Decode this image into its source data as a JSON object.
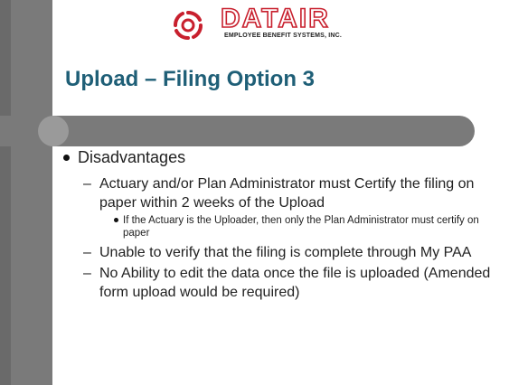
{
  "logo": {
    "wordmark": "DATAIR",
    "subtitle": "EMPLOYEE BENEFIT SYSTEMS, INC.",
    "icon": "datair-swirl-logo-icon"
  },
  "slide": {
    "title": "Upload – Filing Option 3",
    "bullets": [
      {
        "text": "Disadvantages",
        "sub": [
          {
            "text": "Actuary and/or Plan Administrator must Certify the filing on paper within 2 weeks of the Upload",
            "sub": [
              "If the Actuary is the Uploader, then only the Plan Administrator must certify on paper"
            ]
          },
          {
            "text": "Unable to verify that the filing is complete through My PAA"
          },
          {
            "text": "No Ability to edit the data once the file is uploaded (Amended form upload would be required)"
          }
        ]
      }
    ]
  },
  "colors": {
    "title": "#1f5f77",
    "bars": "#7a7a7a",
    "logo_red": "#c8202e"
  }
}
